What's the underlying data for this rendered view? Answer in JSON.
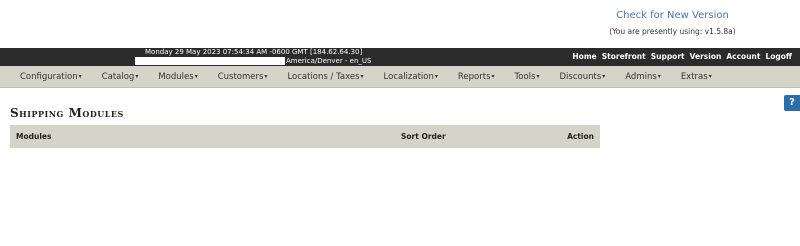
{
  "version": {
    "check_link": "Check for New Version",
    "current_text": "(You are presently using: v1.5.8a)"
  },
  "header": {
    "date_ip": "Monday 29 May 2023 07:54:34 AM -0600 GMT [184.62.64.30]",
    "timezone_locale": "America/Denver - en_US",
    "top_links": [
      "Home",
      "Storefront",
      "Support",
      "Version",
      "Account",
      "Logoff"
    ]
  },
  "menu": {
    "items": [
      "Configuration",
      "Catalog",
      "Modules",
      "Customers",
      "Locations / Taxes",
      "Localization",
      "Reports",
      "Tools",
      "Discounts",
      "Admins",
      "Extras"
    ],
    "caret": "▾"
  },
  "help": {
    "label": "?"
  },
  "page": {
    "title": "Shipping Modules"
  },
  "table": {
    "columns": [
      "Modules",
      "Sort Order",
      "Action"
    ]
  }
}
